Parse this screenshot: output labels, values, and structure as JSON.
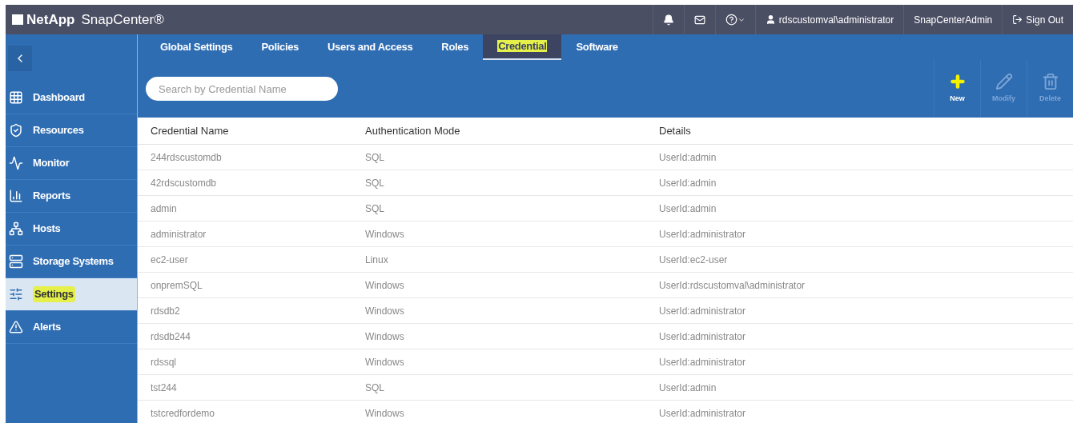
{
  "header": {
    "brand": "NetApp",
    "product": "SnapCenter®",
    "user": "rdscustomval\\administrator",
    "role": "SnapCenterAdmin",
    "sign_out": "Sign Out"
  },
  "sidebar": {
    "items": [
      {
        "label": "Dashboard",
        "selected": false
      },
      {
        "label": "Resources",
        "selected": false
      },
      {
        "label": "Monitor",
        "selected": false
      },
      {
        "label": "Reports",
        "selected": false
      },
      {
        "label": "Hosts",
        "selected": false
      },
      {
        "label": "Storage Systems",
        "selected": false
      },
      {
        "label": "Settings",
        "selected": true
      },
      {
        "label": "Alerts",
        "selected": false
      }
    ]
  },
  "tabs": [
    {
      "label": "Global Settings",
      "selected": false
    },
    {
      "label": "Policies",
      "selected": false
    },
    {
      "label": "Users and Access",
      "selected": false
    },
    {
      "label": "Roles",
      "selected": false
    },
    {
      "label": "Credential",
      "selected": true
    },
    {
      "label": "Software",
      "selected": false
    }
  ],
  "search": {
    "placeholder": "Search by Credential Name"
  },
  "toolbar": [
    {
      "label": "New",
      "disabled": false
    },
    {
      "label": "Modify",
      "disabled": true
    },
    {
      "label": "Delete",
      "disabled": true
    }
  ],
  "table": {
    "columns": [
      "Credential Name",
      "Authentication Mode",
      "Details"
    ],
    "rows": [
      [
        "244rdscustomdb",
        "SQL",
        "UserId:admin"
      ],
      [
        "42rdscustomdb",
        "SQL",
        "UserId:admin"
      ],
      [
        "admin",
        "SQL",
        "UserId:admin"
      ],
      [
        "administrator",
        "Windows",
        "UserId:administrator"
      ],
      [
        "ec2-user",
        "Linux",
        "UserId:ec2-user"
      ],
      [
        "onpremSQL",
        "Windows",
        "UserId:rdscustomval\\administrator"
      ],
      [
        "rdsdb2",
        "Windows",
        "UserId:administrator"
      ],
      [
        "rdsdb244",
        "Windows",
        "UserId:administrator"
      ],
      [
        "rdssql",
        "Windows",
        "UserId:administrator"
      ],
      [
        "tst244",
        "SQL",
        "UserId:admin"
      ],
      [
        "tstcredfordemo",
        "Windows",
        "UserId:administrator"
      ]
    ]
  }
}
